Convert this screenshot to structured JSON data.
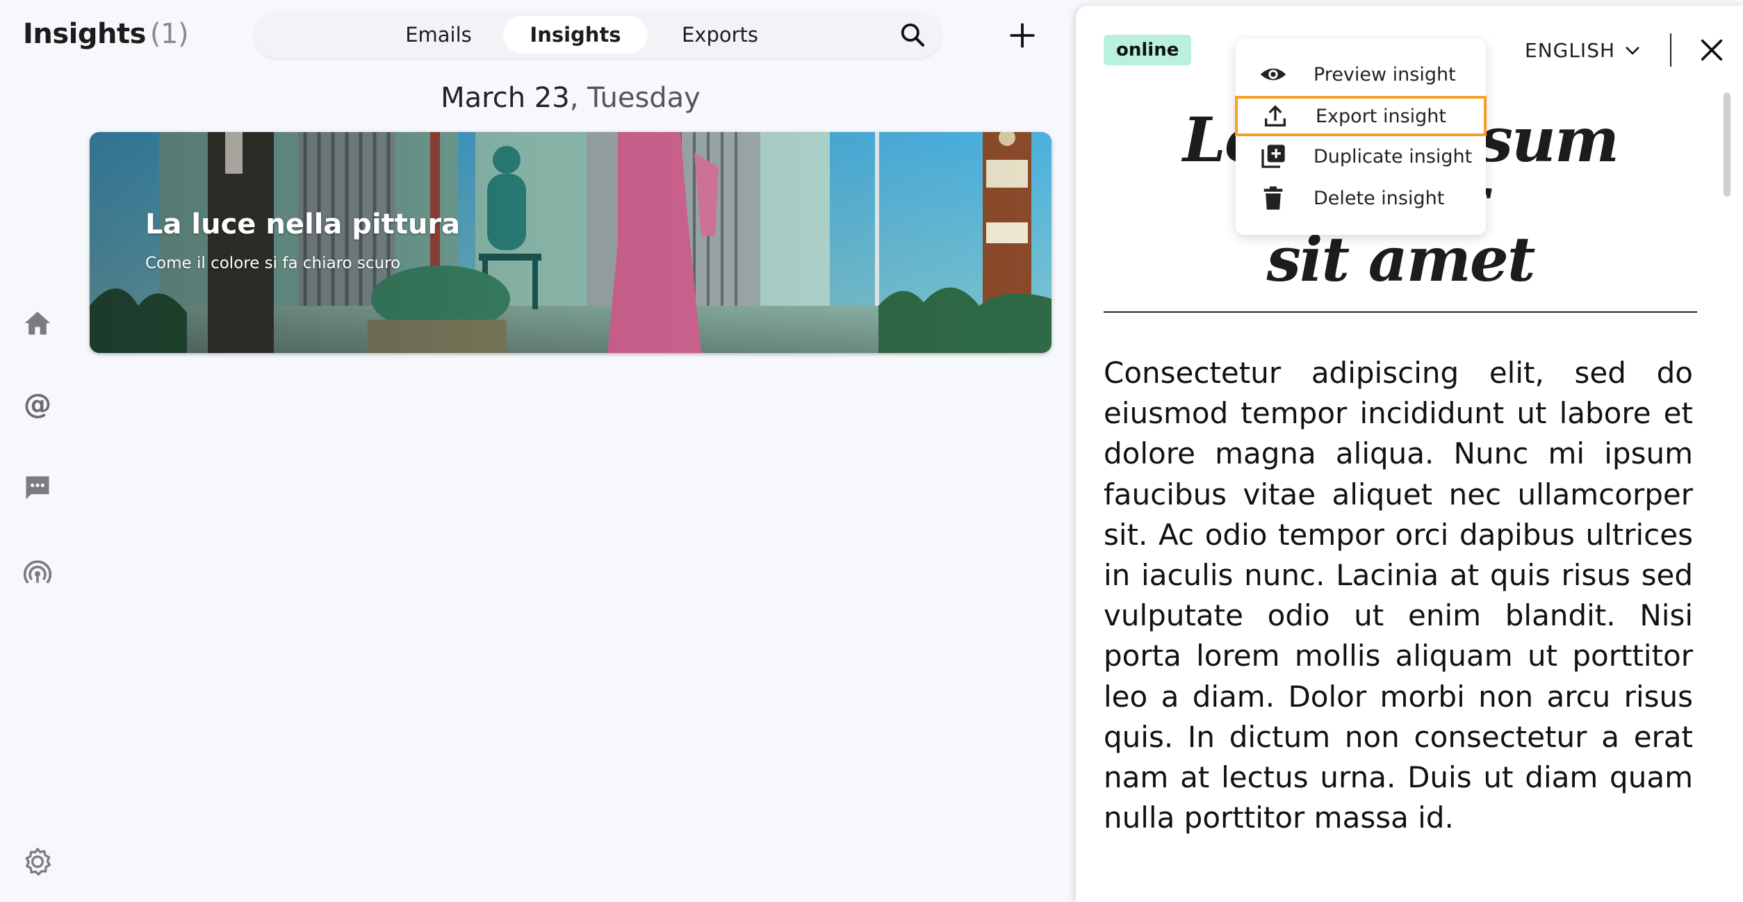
{
  "header": {
    "title": "Insights",
    "count": "(1)",
    "tabs": [
      {
        "label": "Emails",
        "active": false
      },
      {
        "label": "Insights",
        "active": true
      },
      {
        "label": "Exports",
        "active": false
      }
    ],
    "search_icon": "search-icon",
    "add_icon": "plus-icon"
  },
  "sidebar": {
    "icons": [
      "home-icon",
      "at-sign-icon",
      "chat-icon",
      "broadcast-icon",
      "settings-icon"
    ]
  },
  "feed": {
    "date": "March 23",
    "weekday": ", Tuesday",
    "cards": [
      {
        "title": "La luce nella pittura",
        "subtitle": "Come il colore si fa chiaro scuro"
      }
    ]
  },
  "panel": {
    "status_badge": "online",
    "language": "ENGLISH",
    "title_line1": "Lorem ipsum dolor",
    "title_line2": "sit amet",
    "body": "Consectetur adipiscing elit, sed do eiusmod tempor incididunt ut labore et dolore magna aliqua. Nunc mi ipsum faucibus vitae aliquet nec ullamcorper sit. Ac odio tempor orci dapibus ultrices in iaculis nunc. Lacinia at quis risus sed vulputate odio ut enim blandit. Nisi porta lorem mollis aliquam ut porttitor leo a diam. Dolor morbi non arcu risus quis. In dictum non consectetur a erat nam at lectus urna. Duis ut diam quam nulla porttitor massa id."
  },
  "context_menu": {
    "items": [
      {
        "label": "Preview insight",
        "icon": "eye-icon"
      },
      {
        "label": "Export insight",
        "icon": "upload-icon",
        "highlighted": true
      },
      {
        "label": "Duplicate insight",
        "icon": "duplicate-icon"
      },
      {
        "label": "Delete insight",
        "icon": "trash-icon"
      }
    ]
  },
  "colors": {
    "highlight": "#f5a02a",
    "badge": "#b9f0e0",
    "background": "#f7f8fc"
  }
}
